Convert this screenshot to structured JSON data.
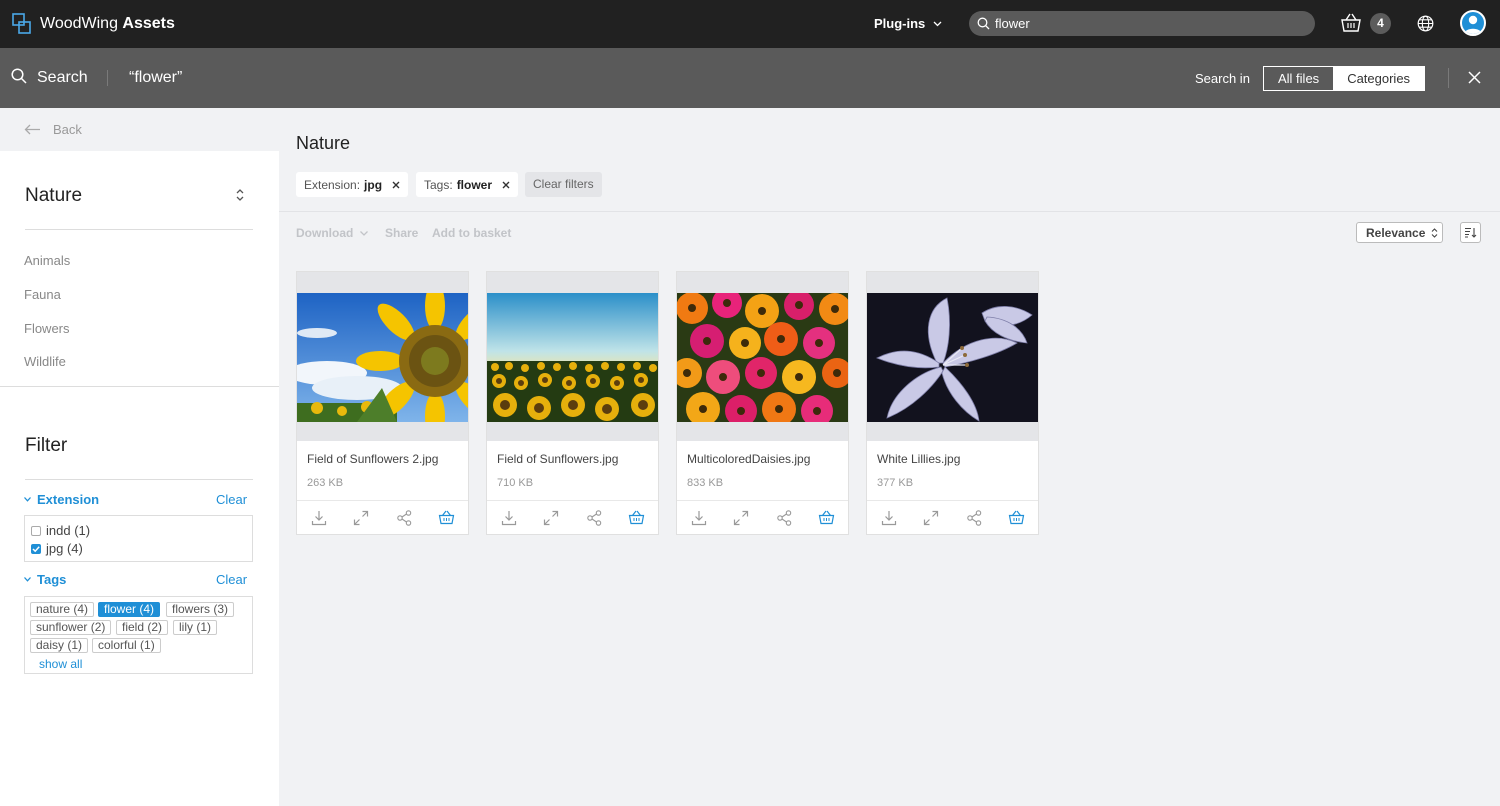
{
  "app": {
    "name_light": "WoodWing",
    "name_bold": "Assets"
  },
  "topbar": {
    "plugins_label": "Plug-ins",
    "search_value": "flower",
    "basket_count": "4"
  },
  "searchbar": {
    "label": "Search",
    "query": "“flower”",
    "search_in_label": "Search in",
    "scope_all": "All files",
    "scope_categories": "Categories"
  },
  "sidebar": {
    "back_label": "Back",
    "category_title": "Nature",
    "categories": [
      "Animals",
      "Fauna",
      "Flowers",
      "Wildlife"
    ],
    "filter_title": "Filter",
    "extension": {
      "title": "Extension",
      "clear": "Clear",
      "options": [
        {
          "label": "indd (1)",
          "checked": false
        },
        {
          "label": "jpg (4)",
          "checked": true
        }
      ]
    },
    "tags": {
      "title": "Tags",
      "clear": "Clear",
      "items": [
        {
          "label": "nature  (4)",
          "active": false
        },
        {
          "label": "flower  (4)",
          "active": true
        },
        {
          "label": "flowers  (3)",
          "active": false
        },
        {
          "label": "sunflower  (2)",
          "active": false
        },
        {
          "label": "field  (2)",
          "active": false
        },
        {
          "label": "lily  (1)",
          "active": false
        },
        {
          "label": "daisy  (1)",
          "active": false
        },
        {
          "label": "colorful  (1)",
          "active": false
        }
      ],
      "show_all": "show all"
    }
  },
  "main": {
    "title": "Nature",
    "chips": [
      {
        "key": "Extension:",
        "value": "jpg"
      },
      {
        "key": "Tags:",
        "value": "flower"
      }
    ],
    "clear_filters": "Clear filters",
    "toolbar": {
      "download": "Download",
      "share": "Share",
      "add_to_basket": "Add to basket",
      "sort": "Relevance"
    },
    "assets": [
      {
        "name": "Field of Sunflowers 2.jpg",
        "size": "263 KB",
        "thumb": "sunflower-closeup"
      },
      {
        "name": "Field of Sunflowers.jpg",
        "size": "710 KB",
        "thumb": "sunflower-field"
      },
      {
        "name": "MulticoloredDaisies.jpg",
        "size": "833 KB",
        "thumb": "daisies"
      },
      {
        "name": "White Lillies.jpg",
        "size": "377 KB",
        "thumb": "lilies"
      }
    ]
  },
  "colors": {
    "accent": "#1f8fd6",
    "topbar": "#212121",
    "searchbar": "#5a5a5a",
    "background": "#f1f2f4"
  }
}
